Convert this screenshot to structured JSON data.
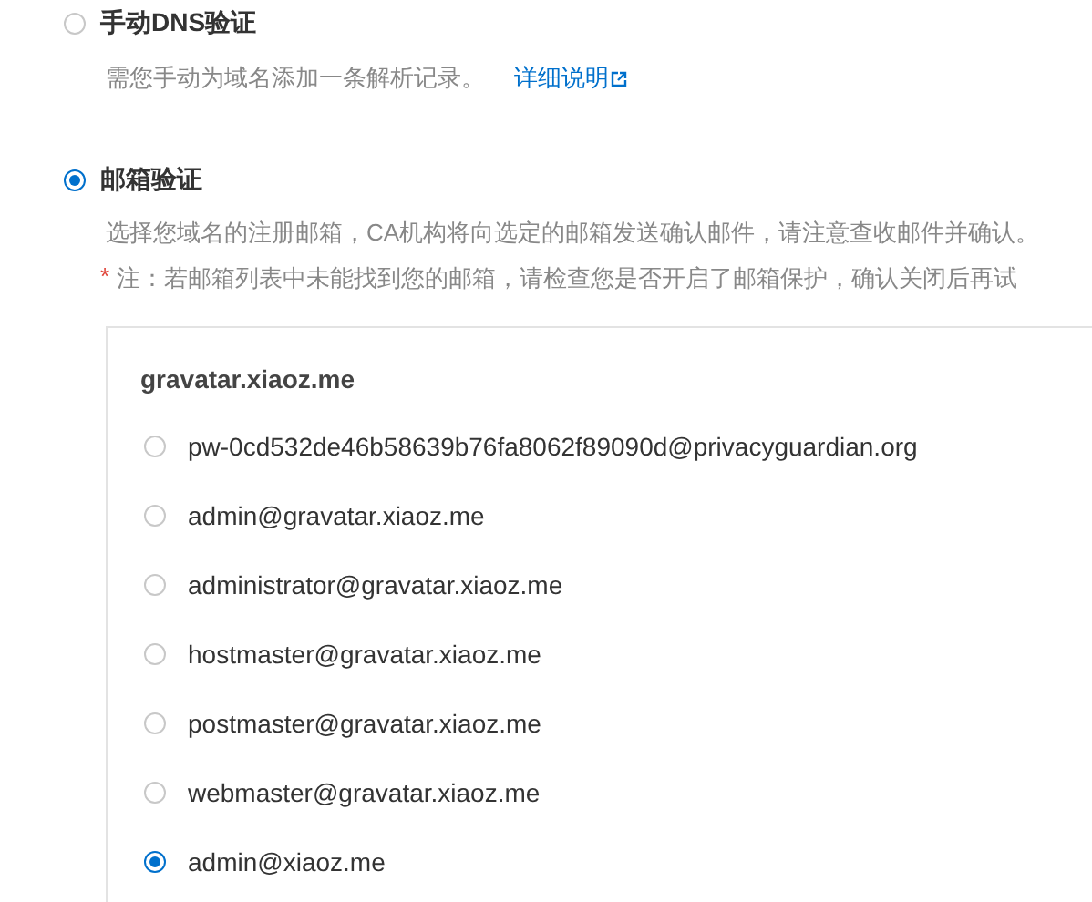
{
  "methods": [
    {
      "title": "手动DNS验证",
      "selected": false,
      "description": "需您手动为域名添加一条解析记录。",
      "link": "详细说明"
    },
    {
      "title": "邮箱验证",
      "selected": true,
      "description": "选择您域名的注册邮箱，CA机构将向选定的邮箱发送确认邮件，请注意查收邮件并确认。",
      "note_mark": "*",
      "note": "注：若邮箱列表中未能找到您的邮箱，请检查您是否开启了邮箱保护，确认关闭后再试"
    }
  ],
  "email_panel": {
    "domain": "gravatar.xiaoz.me",
    "emails": [
      {
        "address": "pw-0cd532de46b58639b76fa8062f89090d@privacyguardian.org",
        "selected": false
      },
      {
        "address": "admin@gravatar.xiaoz.me",
        "selected": false
      },
      {
        "address": "administrator@gravatar.xiaoz.me",
        "selected": false
      },
      {
        "address": "hostmaster@gravatar.xiaoz.me",
        "selected": false
      },
      {
        "address": "postmaster@gravatar.xiaoz.me",
        "selected": false
      },
      {
        "address": "webmaster@gravatar.xiaoz.me",
        "selected": false
      },
      {
        "address": "admin@xiaoz.me",
        "selected": true
      }
    ]
  }
}
